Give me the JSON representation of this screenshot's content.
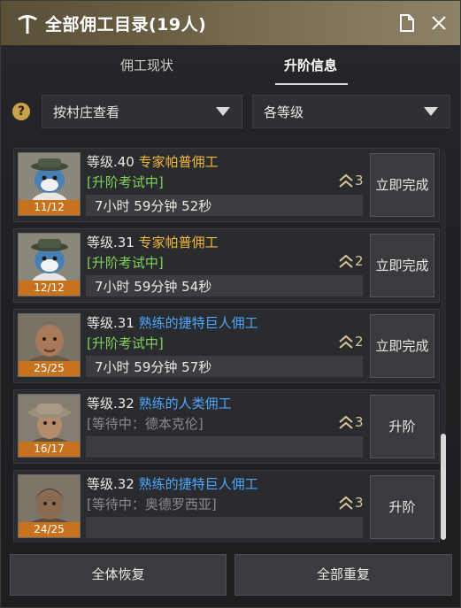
{
  "window": {
    "title": "全部佣工目录(19人)"
  },
  "tabs": [
    {
      "label": "佣工现状"
    },
    {
      "label": "升阶信息"
    }
  ],
  "filters": {
    "help": "?",
    "village": "按村庄查看",
    "level": "各等级"
  },
  "workers": [
    {
      "level": "等级.40",
      "name": "专家帕普佣工",
      "status": "[升阶考试中]",
      "timer": "7小时 59分钟 52秒",
      "rank": "3",
      "count": "11/12",
      "action": "立即完成"
    },
    {
      "level": "等级.31",
      "name": "专家帕普佣工",
      "status": "[升阶考试中]",
      "timer": "7小时 59分钟 54秒",
      "rank": "2",
      "count": "12/12",
      "action": "立即完成"
    },
    {
      "level": "等级.31",
      "name": "熟练的捷特巨人佣工",
      "status": "[升阶考试中]",
      "timer": "7小时 59分钟 57秒",
      "rank": "2",
      "count": "25/25",
      "action": "立即完成"
    },
    {
      "level": "等级.32",
      "name": "熟练的人类佣工",
      "status": "[等待中：德本克伦]",
      "timer": "",
      "rank": "3",
      "count": "16/17",
      "action": "升阶"
    },
    {
      "level": "等级.32",
      "name": "熟练的捷特巨人佣工",
      "status": "[等待中：奥德罗西亚]",
      "timer": "",
      "rank": "3",
      "count": "24/25",
      "action": "升阶"
    }
  ],
  "buttons": {
    "restore_all": "全体恢复",
    "repeat_all": "全部重复"
  },
  "colors": {
    "name_expert": "#f0b93a",
    "name_skilled": "#4ea6ff",
    "status_test": "#7fd15a",
    "status_wait": "#8a8b8d",
    "count_badge": "#c7731e"
  }
}
